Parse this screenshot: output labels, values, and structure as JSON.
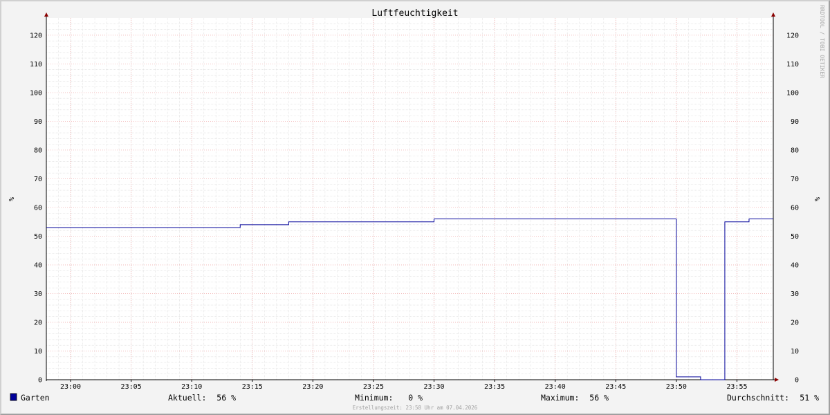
{
  "chart_data": {
    "type": "line",
    "title": "Luftfeuchtigkeit",
    "ylabel": "%",
    "ylabel_right": "%",
    "ylim": [
      0,
      126
    ],
    "y_ticks": [
      0,
      10,
      20,
      30,
      40,
      50,
      60,
      70,
      80,
      90,
      100,
      110,
      120
    ],
    "x_ticks": [
      "23:00",
      "23:05",
      "23:10",
      "23:15",
      "23:20",
      "23:25",
      "23:30",
      "23:35",
      "23:40",
      "23:45",
      "23:50",
      "23:55"
    ],
    "xlim": [
      "22:58",
      "23:58"
    ],
    "grid": true,
    "series": [
      {
        "name": "Garten",
        "color": "#000099",
        "points": [
          [
            "22:58",
            53
          ],
          [
            "23:14",
            54
          ],
          [
            "23:18",
            55
          ],
          [
            "23:30",
            56
          ],
          [
            "23:50",
            1
          ],
          [
            "23:52",
            0
          ],
          [
            "23:54",
            55
          ],
          [
            "23:56",
            56
          ],
          [
            "23:58",
            56
          ]
        ]
      }
    ],
    "legend": {
      "position": "bottom-left",
      "stats": [
        {
          "label": "Aktuell:",
          "value": "56 %"
        },
        {
          "label": "Minimum:",
          "value": "0 %"
        },
        {
          "label": "Maximum:",
          "value": "56 %"
        },
        {
          "label": "Durchschnitt:",
          "value": "51 %"
        }
      ]
    },
    "watermark": "RRDTOOL / TOBI OETIKER",
    "footer": "Erstellungszeit: 23:58 Uhr am 07.04.2026"
  }
}
